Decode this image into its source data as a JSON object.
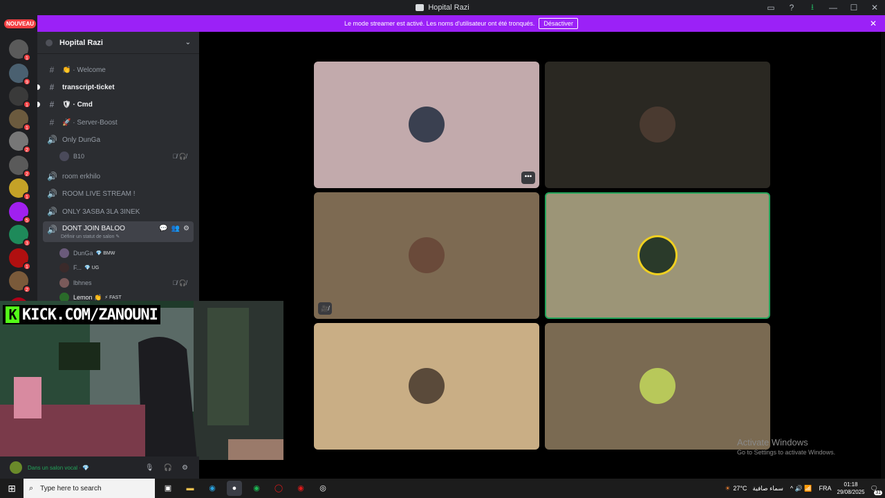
{
  "window": {
    "title": "Hopital Razi",
    "controls": [
      "▭",
      "?",
      "⭳",
      "—",
      "☐",
      "✕"
    ]
  },
  "banner": {
    "message": "Le mode streamer est activé. Les noms d'utilisateur ont été tronqués.",
    "button": "Désactiver",
    "close": "✕",
    "color": "#9b21f7"
  },
  "rail": {
    "new_label": "NOUVEAU",
    "servers": [
      {
        "badge": "1",
        "color": "#5a5a5a"
      },
      {
        "badge": "9",
        "color": "#4a6070"
      },
      {
        "badge": "1",
        "color": "#3a3a3a"
      },
      {
        "badge": "1",
        "color": "#6b5a3e"
      },
      {
        "badge": "2",
        "color": "#777777"
      },
      {
        "badge": "2",
        "color": "#5a5a5a"
      },
      {
        "badge": "1",
        "color": "#c4a227"
      },
      {
        "badge": "5",
        "color": "#a020f0"
      },
      {
        "badge": "3",
        "color": "#1e8a5a"
      },
      {
        "badge": "1",
        "color": "#b01010"
      },
      {
        "badge": "2",
        "color": "#7a5a3a"
      },
      {
        "badge": "",
        "color": "#b00018"
      }
    ]
  },
  "sidebar": {
    "guild_name": "Hopital Razi",
    "channels": [
      {
        "icon": "#",
        "label": "👏 · Welcome",
        "type": "text",
        "unread": false
      },
      {
        "icon": "#",
        "label": "transcript-ticket",
        "type": "text",
        "unread": true
      },
      {
        "icon": "#",
        "label": "🛡 · Cmd",
        "type": "text",
        "unread": true
      },
      {
        "icon": "#",
        "label": "🚀 · Server-Boost",
        "type": "text",
        "unread": false
      },
      {
        "icon": "🔊",
        "label": "Only DunGa",
        "type": "voice",
        "unread": false
      },
      {
        "icon": "🔊",
        "label": "room erkhilo",
        "type": "voice",
        "unread": false
      },
      {
        "icon": "🔊",
        "label": "ROOM LIVE STREAM !",
        "type": "voice",
        "unread": false
      },
      {
        "icon": "🔊",
        "label": "ONLY 3ASBA 3LA 3INEK",
        "type": "voice",
        "unread": false
      },
      {
        "icon": "🔊",
        "label": "DONT JOIN BALOO",
        "type": "voice",
        "unread": false,
        "active": true,
        "status_hint": "Définir un statut de salon ✎"
      }
    ],
    "only_dunga_members": [
      {
        "name": "B10",
        "tag": "",
        "mute": "🎙̸ 🎧̸"
      }
    ],
    "balou_members": [
      {
        "name": "DunGa",
        "tag": "💎 BMW",
        "mute": ""
      },
      {
        "name": "F...",
        "tag": "💎 UG",
        "mute": ""
      },
      {
        "name": "lbhnes",
        "tag": "",
        "mute": "🎙̸ 🎧̸"
      },
      {
        "name": "Lemon 👏",
        "tag": "⚡ FAST",
        "mute": ""
      }
    ]
  },
  "stage": {
    "tiles": [
      {
        "bg": "#c2aaac",
        "avatar": "#3a4050",
        "overlay": "•••",
        "speaking": false
      },
      {
        "bg": "#2a2822",
        "avatar": "#4a3a30",
        "overlay": "",
        "speaking": false
      },
      {
        "bg": "#7d6a52",
        "avatar": "#6a4a3a",
        "overlay": "🎥̸",
        "speaking": false
      },
      {
        "bg": "#9c9577",
        "avatar": "#2a3a2a",
        "overlay": "",
        "speaking": true
      },
      {
        "bg": "#c9ae85",
        "avatar": "#5a4a3a",
        "overlay": "",
        "speaking": false
      },
      {
        "bg": "#7a6a52",
        "avatar": "#b8c85a",
        "overlay": "",
        "speaking": false
      }
    ],
    "watermark_title": "Activate Windows",
    "watermark_sub": "Go to Settings to activate Windows."
  },
  "camera_overlay": {
    "k": "K",
    "url": "KICK.COM/ZANOUNI"
  },
  "user_panel": {
    "status": "Dans un salon vocal · 💎",
    "controls": [
      "🎙",
      "🎧",
      "⚙"
    ]
  },
  "taskbar": {
    "search_placeholder": "Type here to search",
    "weather": "27°C",
    "weather_desc": "سماء صافية",
    "tray": "^ 🔊 📶",
    "lang": "FRA",
    "time": "01:18",
    "date": "29/08/2025",
    "notif_count": "31"
  }
}
